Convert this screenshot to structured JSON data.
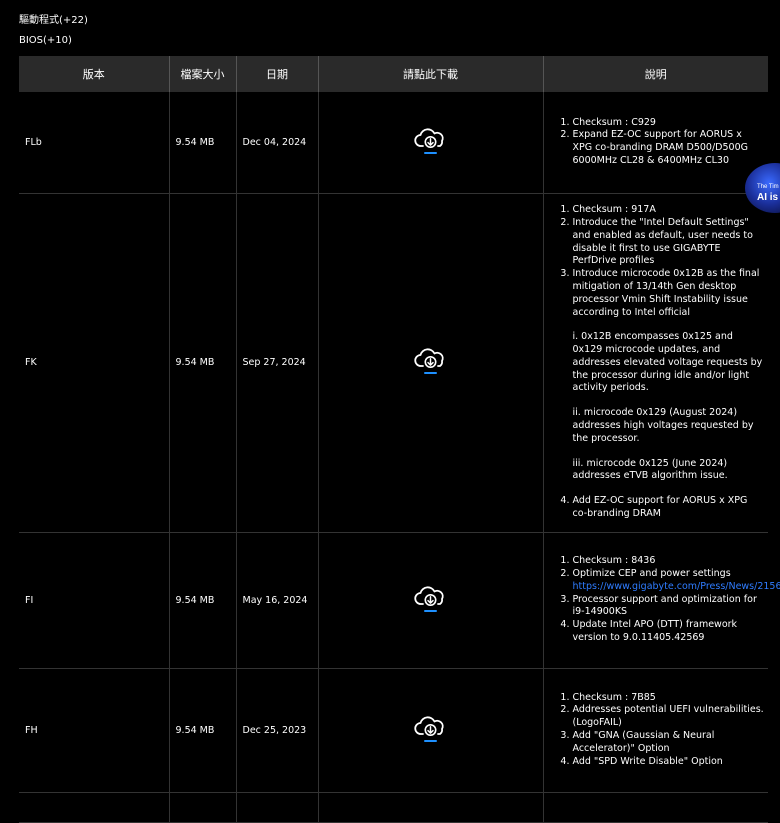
{
  "nav": {
    "drivers_label": "驅動程式(+22)",
    "bios_label": "BIOS(+10)"
  },
  "table": {
    "headers": {
      "version": "版本",
      "size": "檔案大小",
      "date": "日期",
      "download": "請點此下載",
      "description": "說明"
    },
    "rows": [
      {
        "version": "FLb",
        "size": "9.54 MB",
        "date": "Dec 04, 2024",
        "items": [
          "Checksum : C929",
          "Expand EZ-OC support for AORUS x XPG co-branding DRAM D500/D500G 6000MHz CL28 & 6400MHz CL30"
        ]
      },
      {
        "version": "FK",
        "size": "9.54 MB",
        "date": "Sep 27, 2024",
        "items": [
          "Checksum : 917A",
          "Introduce the \"Intel Default Settings\" and enabled as default, user needs to disable it first to use GIGABYTE PerfDrive profiles",
          "Introduce microcode 0x12B as the final mitigation of 13/14th Gen desktop processor Vmin Shift Instability issue according to Intel official",
          "Add EZ-OC support for AORUS x XPG co-branding DRAM"
        ],
        "sub_notes": [
          "i. 0x12B encompasses 0x125 and 0x129 microcode updates, and addresses elevated voltage requests by the processor during idle and/or light activity periods.",
          "ii. microcode 0x129 (August 2024) addresses high voltages requested by the processor.",
          "iii. microcode 0x125 (June 2024) addresses eTVB algorithm issue."
        ]
      },
      {
        "version": "FI",
        "size": "9.54 MB",
        "date": "May 16, 2024",
        "items": [
          "Checksum : 8436",
          "Optimize CEP and power settings",
          "Processor support and optimization for i9-14900KS",
          "Update Intel APO (DTT) framework version to 9.0.11405.42569"
        ],
        "link": "https://www.gigabyte.com/Press/News/2156"
      },
      {
        "version": "FH",
        "size": "9.54 MB",
        "date": "Dec 25, 2023",
        "items": [
          "Checksum : 7B85",
          "Addresses potential UEFI vulnerabilities. (LogoFAIL)",
          "Add \"GNA (Gaussian & Neural Accelerator)\" Option",
          "Add \"SPD Write Disable\" Option"
        ]
      }
    ]
  },
  "badge": {
    "line1": "The Tim",
    "line2": "AI is N"
  },
  "colors": {
    "background": "#000000",
    "header_bg": "#2a2a2a",
    "link": "#2f7cff",
    "icon_accent": "#1e90ff"
  },
  "icons": {
    "download": "cloud-download-icon"
  }
}
